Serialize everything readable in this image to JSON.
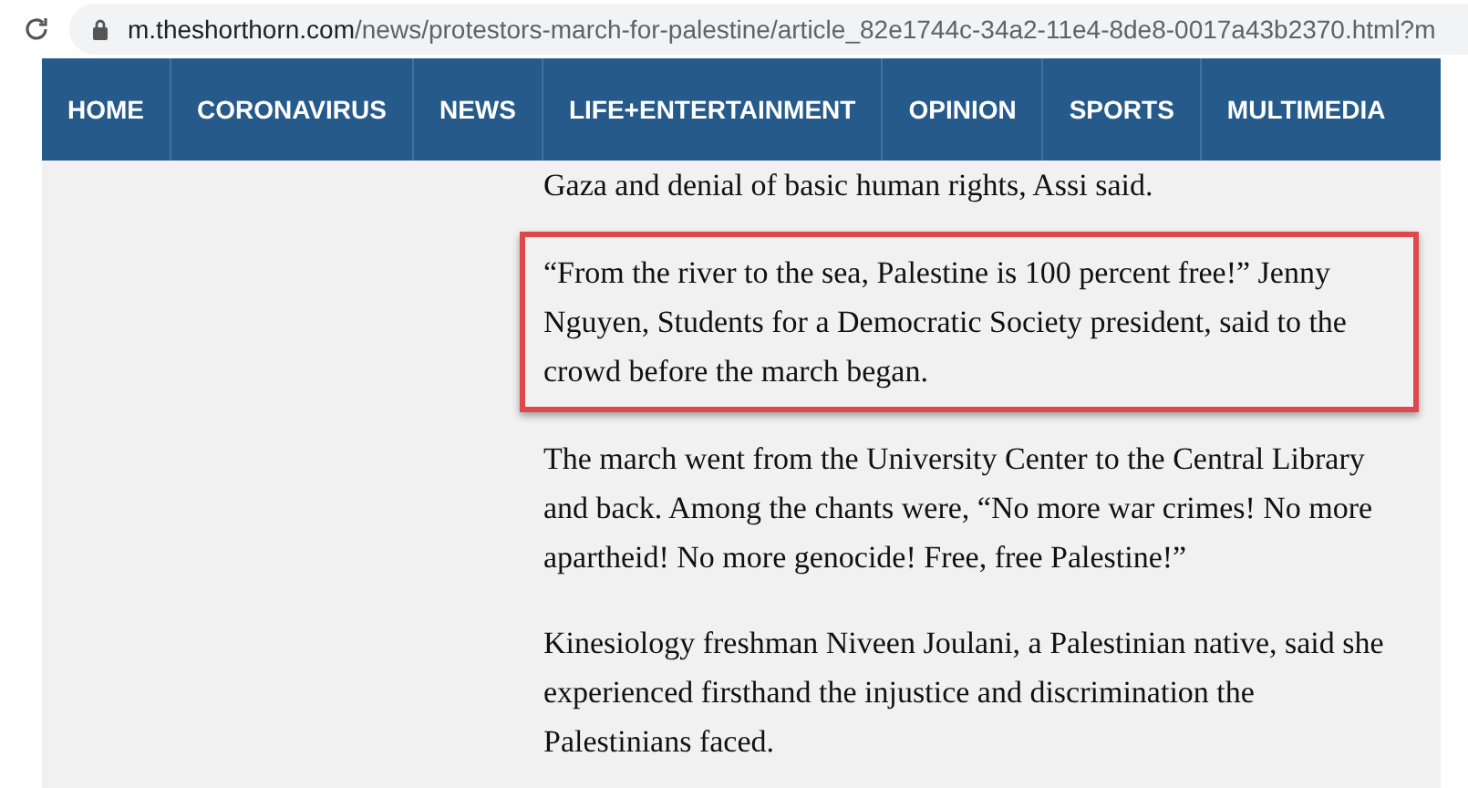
{
  "address_bar": {
    "domain": "m.theshorthorn.com",
    "path": "/news/protestors-march-for-palestine/article_82e1744c-34a2-11e4-8de8-0017a43b2370.html?m"
  },
  "nav": [
    {
      "label": "HOME"
    },
    {
      "label": "CORONAVIRUS"
    },
    {
      "label": "NEWS"
    },
    {
      "label": "LIFE+ENTERTAINMENT"
    },
    {
      "label": "OPINION"
    },
    {
      "label": "SPORTS"
    },
    {
      "label": "MULTIMEDIA"
    }
  ],
  "paragraphs": [
    {
      "text": "Gaza and denial of basic human rights, Assi said.",
      "highlighted": false
    },
    {
      "text": "“From the river to the sea, Palestine is 100 percent free!” Jenny Nguyen, Students for a Democratic Society president, said to the crowd before the march began.",
      "highlighted": true
    },
    {
      "text": "The march went from the University Center to the Central Library and back. Among the chants were, “No more war crimes! No more apartheid! No more genocide! Free, free Palestine!”",
      "highlighted": false
    },
    {
      "text": "Kinesiology freshman Niveen Joulani, a Palestinian native, said she experienced firsthand the injustice and discrimination the Palestinians faced.",
      "highlighted": false
    }
  ]
}
